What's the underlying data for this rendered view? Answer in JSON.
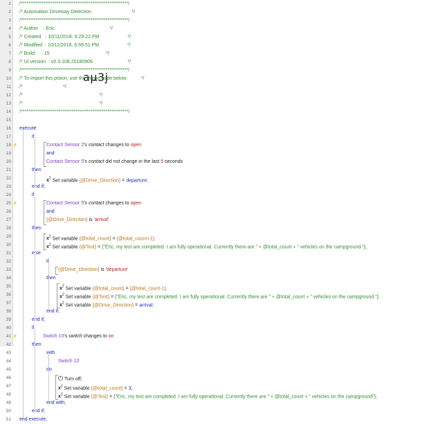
{
  "header_lines": [
    "/*********************************************************/",
    "/* Automation Driveway Detection                              */",
    "/*********************************************************/",
    "/* Author    : Eric                                         */",
    "/* Created   : 10/11/2018, 6:29:22 PM                     */",
    "/* Modified  : 10/11/2018, 6:59:51 PM                     */",
    "/* Build     : 15                                          */",
    "/* UI version  : v0.3.108.20180906                          */",
    "/*********************************************************/",
    "/* To import this piston, use the import code below:          */",
    "/*                              */",
    "/*                                                         */",
    "/*                                                         */",
    "/*********************************************************/"
  ],
  "import_code": "aµ3j",
  "line_numbers": [
    "1",
    "2",
    "3",
    "4",
    "5",
    "6",
    "7",
    "8",
    "9",
    "10",
    "11",
    "12",
    "13",
    "14",
    "15",
    "16",
    "17",
    "18",
    "19",
    "20",
    "21",
    "22",
    "23",
    "24",
    "25",
    "26",
    "27",
    "28",
    "29",
    "30",
    "31",
    "32",
    "33",
    "34",
    "35",
    "36",
    "37",
    "38",
    "39",
    "40",
    "41",
    "42",
    "43",
    "44",
    "45",
    "46",
    "47",
    "48",
    "49",
    "50",
    "51"
  ],
  "kw": {
    "execute": "execute",
    "if": "if",
    "then": "then",
    "else": "else",
    "and": "and",
    "end_if": "end if;",
    "with": "with",
    "do": "do",
    "end_with": "end with;",
    "end_execute": "end execute;",
    "is": "is",
    "set_variable": "Set variable",
    "turn_off": "Turn off;"
  },
  "conditions": {
    "c18_device": "Contact Sensor 2",
    "c18_mid": "'s ",
    "c18_attr": "contact",
    "c18_op": " changes to ",
    "c18_val": "open",
    "c20_device": "Contact Sensor 5",
    "c20_mid": "'s ",
    "c20_attr": "contact",
    "c20_op": " did not change in the last ",
    "c20_val": "5",
    "c20_unit": " seconds",
    "c25_device": "Contact Sensor 5",
    "c25_mid": "'s ",
    "c25_attr": "contact",
    "c25_op": " changes to ",
    "c25_val": "open",
    "c27_var": "{@Drive_Direction}",
    "c27_val": "'arrival'",
    "c33_var": "{@Drive_Direction}",
    "c33_val": "'departure'",
    "c41_device": "Switch 10",
    "c41_mid": "'s ",
    "c41_attr": "switch",
    "c41_op": " changes to ",
    "c41_val": "on",
    "c44_device": "Switch 10"
  },
  "actions": {
    "a22_var": "{@Drive_Direction}",
    "a22_eq": " = ",
    "a22_val": "departure;",
    "a29_var": "{@total_count}",
    "a29_eq": " = ",
    "a29_val": "{@total_count+1};",
    "a30_var": "{@Test}",
    "a30_eq": " = ",
    "a30_val": "{\"Eric, my test are completed. I am fully operational. Currently there are \" + @total_count + \" vehicles on the campground.\"};",
    "a35_var": "{@total_count}",
    "a35_eq": " = ",
    "a35_val": "{@total_count-1};",
    "a36_var": "{@Test}",
    "a36_eq": " = ",
    "a36_val": "{\"Eric, my test are completed. I am fully operational. Currently there are \" + @total_count + \" vehicles on the campground.\"};",
    "a37_var": "{@Drive_Direction}",
    "a37_eq": " = ",
    "a37_val": "arrival;",
    "a47_var": "{@total_count}",
    "a47_eq": " = ",
    "a47_val": "3;",
    "a48_var": "{@Test}",
    "a48_eq": " = ",
    "a48_val": "{\"Eric, my test are completed. I am fully operational. Currently there are \" + @total_count + \" vehicles on the campground\"};"
  },
  "colors": {
    "comment": "#2e8b2e",
    "keyword": "#1a2ab8",
    "device": "#7b3fc4",
    "value": "#b22222",
    "variable": "#b7731a",
    "trigger_mark": "#e07a1f"
  },
  "icons": {
    "trigger": "lightning-icon",
    "variable": "x2-icon",
    "power": "power-icon"
  }
}
